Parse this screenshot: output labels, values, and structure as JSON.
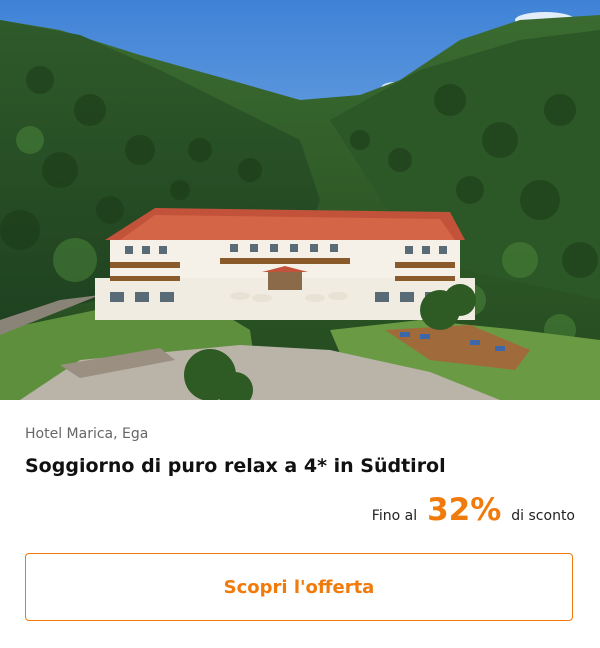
{
  "hero_image": {
    "alt_icon": "hotel-photo"
  },
  "offer": {
    "location": "Hotel Marica, Ega",
    "title": "Soggiorno di puro relax a 4* in Südtirol",
    "discount_prefix": "Fino al",
    "discount_value": "32%",
    "discount_suffix": "di sconto"
  },
  "cta": {
    "label": "Scopri l'offerta"
  },
  "colors": {
    "accent": "#f07b0c",
    "title": "#111111",
    "muted": "#666666"
  }
}
